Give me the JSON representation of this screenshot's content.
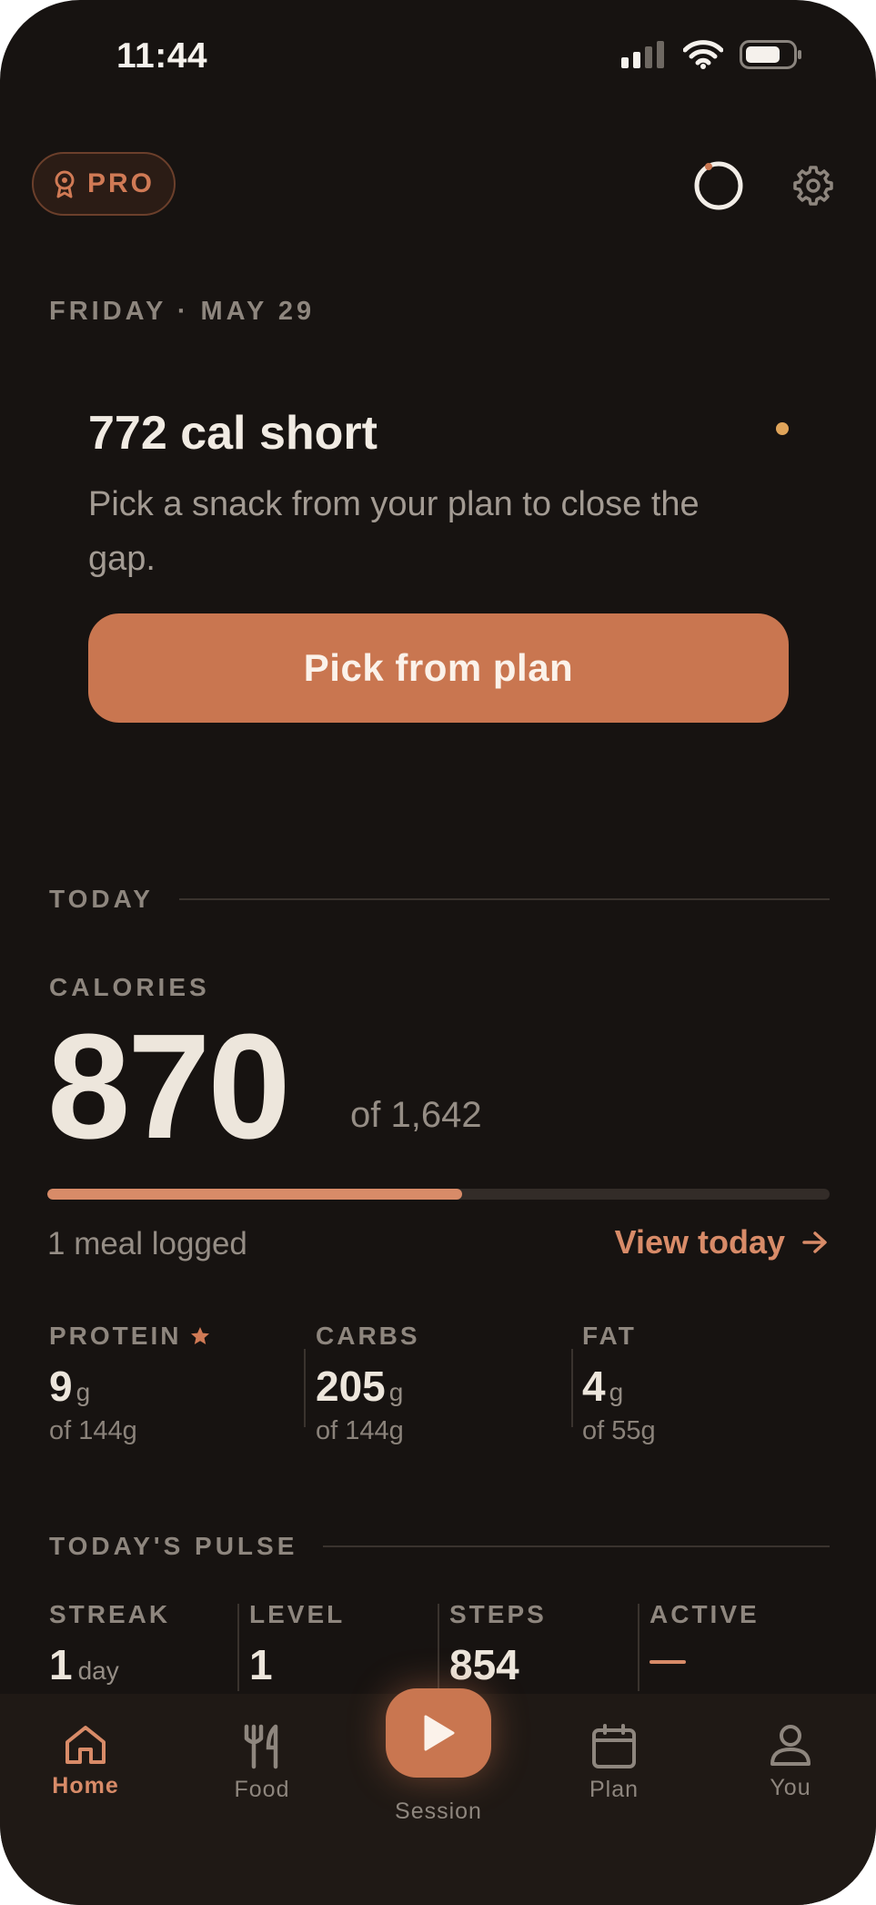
{
  "status_bar": {
    "time": "11:44"
  },
  "header": {
    "pro_label": "PRO"
  },
  "date": "FRIDAY · MAY 29",
  "prompt_card": {
    "title": "772 cal short",
    "body": "Pick a snack from your plan to close the gap.",
    "button_label": "Pick from plan"
  },
  "today": {
    "section_label": "TODAY",
    "calories_label": "CALORIES",
    "calories_value": "870",
    "calories_goal": "of 1,642",
    "progress_fraction": 0.53,
    "meals_logged": "1 meal logged",
    "view_today_label": "View today"
  },
  "macros": [
    {
      "label": "PROTEIN",
      "value": "9",
      "unit": "g",
      "goal": "of 144g",
      "starred": true
    },
    {
      "label": "CARBS",
      "value": "205",
      "unit": "g",
      "goal": "of 144g",
      "starred": false
    },
    {
      "label": "FAT",
      "value": "4",
      "unit": "g",
      "goal": "of 55g",
      "starred": false
    }
  ],
  "pulse": {
    "section_label": "TODAY'S PULSE",
    "items": [
      {
        "label": "STREAK",
        "value": "1",
        "unit": "day"
      },
      {
        "label": "LEVEL",
        "value": "1",
        "unit": ""
      },
      {
        "label": "STEPS",
        "value": "854",
        "unit": ""
      },
      {
        "label": "ACTIVE",
        "value": "",
        "unit": ""
      }
    ]
  },
  "tabs": {
    "home": "Home",
    "food": "Food",
    "session": "Session",
    "plan": "Plan",
    "you": "You"
  },
  "colors": {
    "background": "#171311",
    "accent": "#c97650",
    "accent_text": "#d88b68",
    "dot": "#e0a45a"
  }
}
